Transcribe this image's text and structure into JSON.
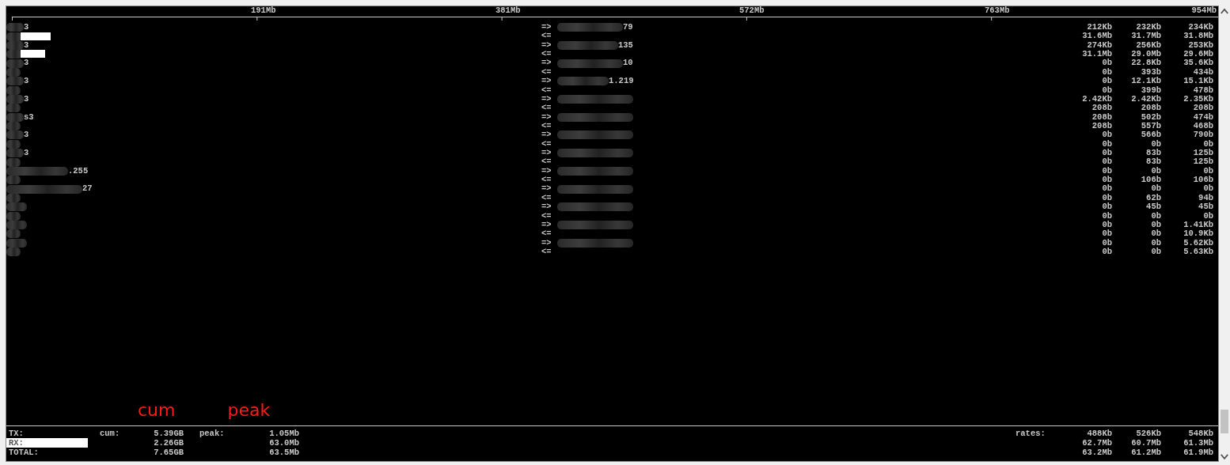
{
  "scale": {
    "ticks": [
      "191Mb",
      "381Mb",
      "572Mb",
      "763Mb",
      "954Mb"
    ]
  },
  "flows": [
    {
      "source": "3",
      "source_whiteout": true,
      "out_arrow": "=>",
      "in_arrow": "<=",
      "dest": "79",
      "sent": [
        "212Kb",
        "232Kb",
        "234Kb"
      ],
      "received": [
        "31.6Mb",
        "31.7Mb",
        "31.8Mb"
      ]
    },
    {
      "source": "3",
      "source_whiteout": true,
      "out_arrow": "=>",
      "in_arrow": "<=",
      "dest": "135",
      "sent": [
        "274Kb",
        "256Kb",
        "253Kb"
      ],
      "received": [
        "31.1Mb",
        "29.0Mb",
        "29.6Mb"
      ]
    },
    {
      "source": "3",
      "source_whiteout": false,
      "out_arrow": "=>",
      "in_arrow": "<=",
      "dest": "10",
      "sent": [
        "0b",
        "22.8Kb",
        "35.6Kb"
      ],
      "received": [
        "0b",
        "393b",
        "434b"
      ]
    },
    {
      "source": "3",
      "source_whiteout": false,
      "out_arrow": "=>",
      "in_arrow": "<=",
      "dest": "1.219",
      "sent": [
        "0b",
        "12.1Kb",
        "15.1Kb"
      ],
      "received": [
        "0b",
        "399b",
        "478b"
      ]
    },
    {
      "source": "3",
      "source_whiteout": false,
      "out_arrow": "=>",
      "in_arrow": "<=",
      "sent": [
        "2.42Kb",
        "2.42Kb",
        "2.35Kb"
      ],
      "received": [
        "208b",
        "208b",
        "208b"
      ]
    },
    {
      "source": "s3",
      "source_whiteout": false,
      "out_arrow": "=>",
      "in_arrow": "<=",
      "sent": [
        "208b",
        "502b",
        "474b"
      ],
      "received": [
        "208b",
        "557b",
        "468b"
      ]
    },
    {
      "source": "3",
      "source_whiteout": false,
      "out_arrow": "=>",
      "in_arrow": "<=",
      "sent": [
        "0b",
        "566b",
        "790b"
      ],
      "received": [
        "0b",
        "0b",
        "0b"
      ]
    },
    {
      "source": "3",
      "source_whiteout": false,
      "out_arrow": "=>",
      "in_arrow": "<=",
      "sent": [
        "0b",
        "83b",
        "125b"
      ],
      "received": [
        "0b",
        "83b",
        "125b"
      ]
    },
    {
      "source": ".255",
      "source_whiteout": false,
      "out_arrow": "=>",
      "in_arrow": "<=",
      "sent": [
        "0b",
        "0b",
        "0b"
      ],
      "received": [
        "0b",
        "106b",
        "106b"
      ]
    },
    {
      "source": "27",
      "source_whiteout": false,
      "out_arrow": "=>",
      "in_arrow": "<=",
      "sent": [
        "0b",
        "0b",
        "0b"
      ],
      "received": [
        "0b",
        "62b",
        "94b"
      ]
    },
    {
      "source_whiteout": false,
      "out_arrow": "=>",
      "in_arrow": "<=",
      "sent": [
        "0b",
        "45b",
        "45b"
      ],
      "received": [
        "0b",
        "0b",
        "0b"
      ]
    },
    {
      "source_whiteout": false,
      "out_arrow": "=>",
      "in_arrow": "<=",
      "sent": [
        "0b",
        "0b",
        "1.41Kb"
      ],
      "received": [
        "0b",
        "0b",
        "10.9Kb"
      ]
    },
    {
      "source_whiteout": false,
      "out_arrow": "=>",
      "in_arrow": "<=",
      "sent": [
        "0b",
        "0b",
        "5.62Kb"
      ],
      "received": [
        "0b",
        "0b",
        "5.63Kb"
      ]
    }
  ],
  "annotations": [
    "cum",
    "peak"
  ],
  "totals": [
    {
      "label": "TX:",
      "whiteout": false,
      "cum_label": "cum:",
      "cum": "5.39GB",
      "peak_label": "peak:",
      "peak": "1.05Mb",
      "rates_label": "rates:",
      "rates": [
        "488Kb",
        "526Kb",
        "548Kb"
      ]
    },
    {
      "label": "RX:",
      "whiteout": true,
      "cum": "2.26GB",
      "peak": "63.0Mb",
      "rates": [
        "62.7Mb",
        "60.7Mb",
        "61.3Mb"
      ]
    },
    {
      "label": "TOTAL:",
      "whiteout": false,
      "cum": "7.65GB",
      "peak": "63.5Mb",
      "rates": [
        "63.2Mb",
        "61.2Mb",
        "61.9Mb"
      ]
    }
  ]
}
